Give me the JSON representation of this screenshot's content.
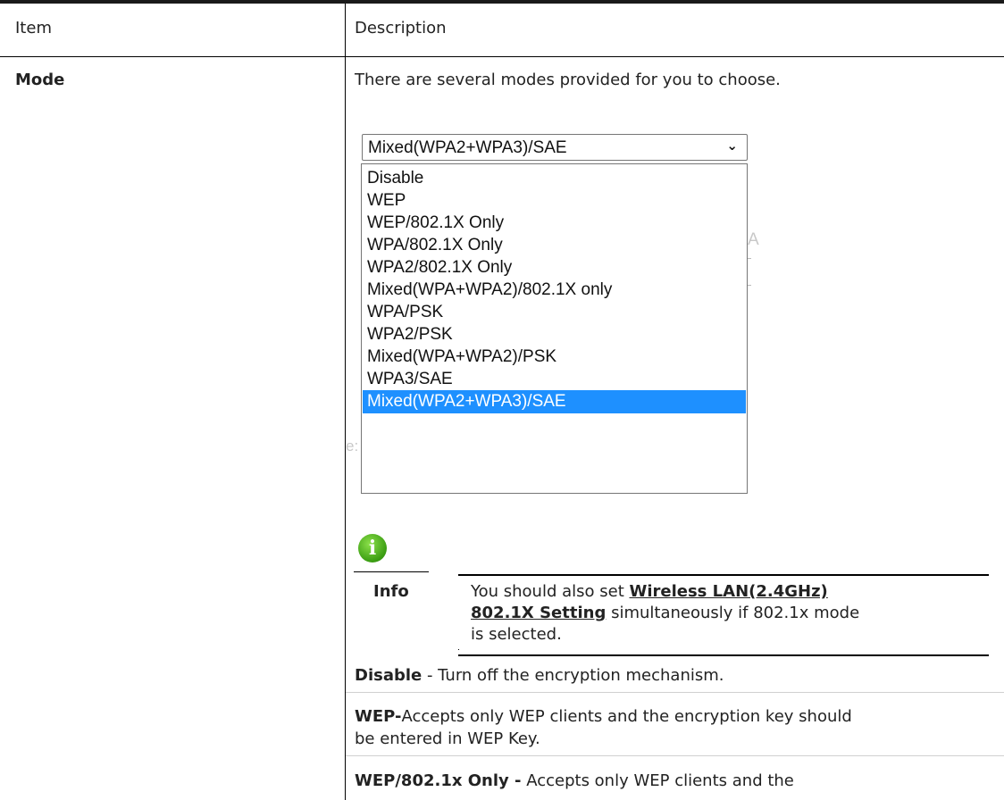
{
  "table": {
    "header_item": "Item",
    "header_description": "Description"
  },
  "row": {
    "item": "Mode",
    "intro": "There are several modes provided for you to choose.",
    "select_value": "Mixed(WPA2+WPA3)/SAE",
    "options": [
      "Disable",
      "WEP",
      "WEP/802.1X Only",
      "WPA/802.1X Only",
      "WPA2/802.1X Only",
      "Mixed(WPA+WPA2)/802.1X only",
      "WPA/PSK",
      "WPA2/PSK",
      "Mixed(WPA+WPA2)/PSK",
      "WPA3/SAE",
      "Mixed(WPA2+WPA3)/SAE"
    ],
    "selected_index": 10,
    "info_label": "Info",
    "info_line1_pre": "You should also set ",
    "info_link_1": "Wireless LAN(2.4GHz) ",
    "info_link_2": "802.1X Setting",
    "info_line2_post": " simultaneously if 802.1x mode",
    "info_line3": "is selected.",
    "disable_term": "Disable",
    "disable_desc": " - Turn off the encryption mechanism.",
    "wep_term": "WEP-",
    "wep_desc_1": "Accepts only WEP clients and the encryption key should",
    "wep_desc_2": "be entered in WEP Key.",
    "wep8021x_term": "WEP/802.1x Only -",
    "wep8021x_desc": " Accepts only WEP clients and the"
  },
  "colors": {
    "selected_option_bg": "#1e90ff",
    "info_icon": "#3a9d12"
  },
  "icons": {
    "info": "info-icon",
    "dropdown": "chevron-down-icon"
  }
}
